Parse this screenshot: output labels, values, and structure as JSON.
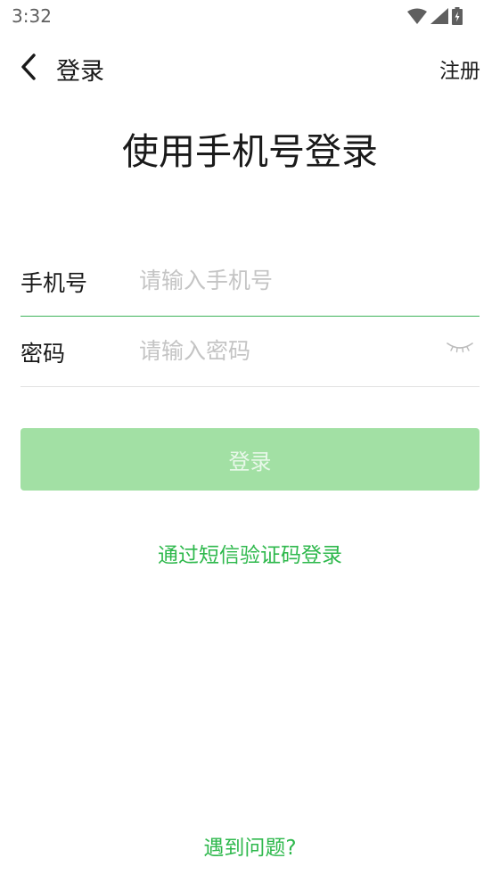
{
  "status_bar": {
    "time": "3:32",
    "icons": [
      "wifi-icon",
      "cellular-signal-icon",
      "battery-charging-icon"
    ]
  },
  "nav": {
    "back_icon": "chevron-left-icon",
    "title": "登录",
    "register_label": "注册"
  },
  "page_title": "使用手机号登录",
  "form": {
    "phone": {
      "label": "手机号",
      "placeholder": "请输入手机号",
      "value": ""
    },
    "password": {
      "label": "密码",
      "placeholder": "请输入密码",
      "value": "",
      "toggle_icon": "eye-closed-icon"
    }
  },
  "login_button": {
    "label": "登录",
    "enabled": false
  },
  "sms_login_link": "通过短信验证码登录",
  "help_link": "遇到问题?",
  "colors": {
    "accent": "#2eb84c",
    "button_disabled_bg": "#a2e0a4",
    "active_underline": "#3fb35c",
    "placeholder": "#c4c4c4"
  }
}
